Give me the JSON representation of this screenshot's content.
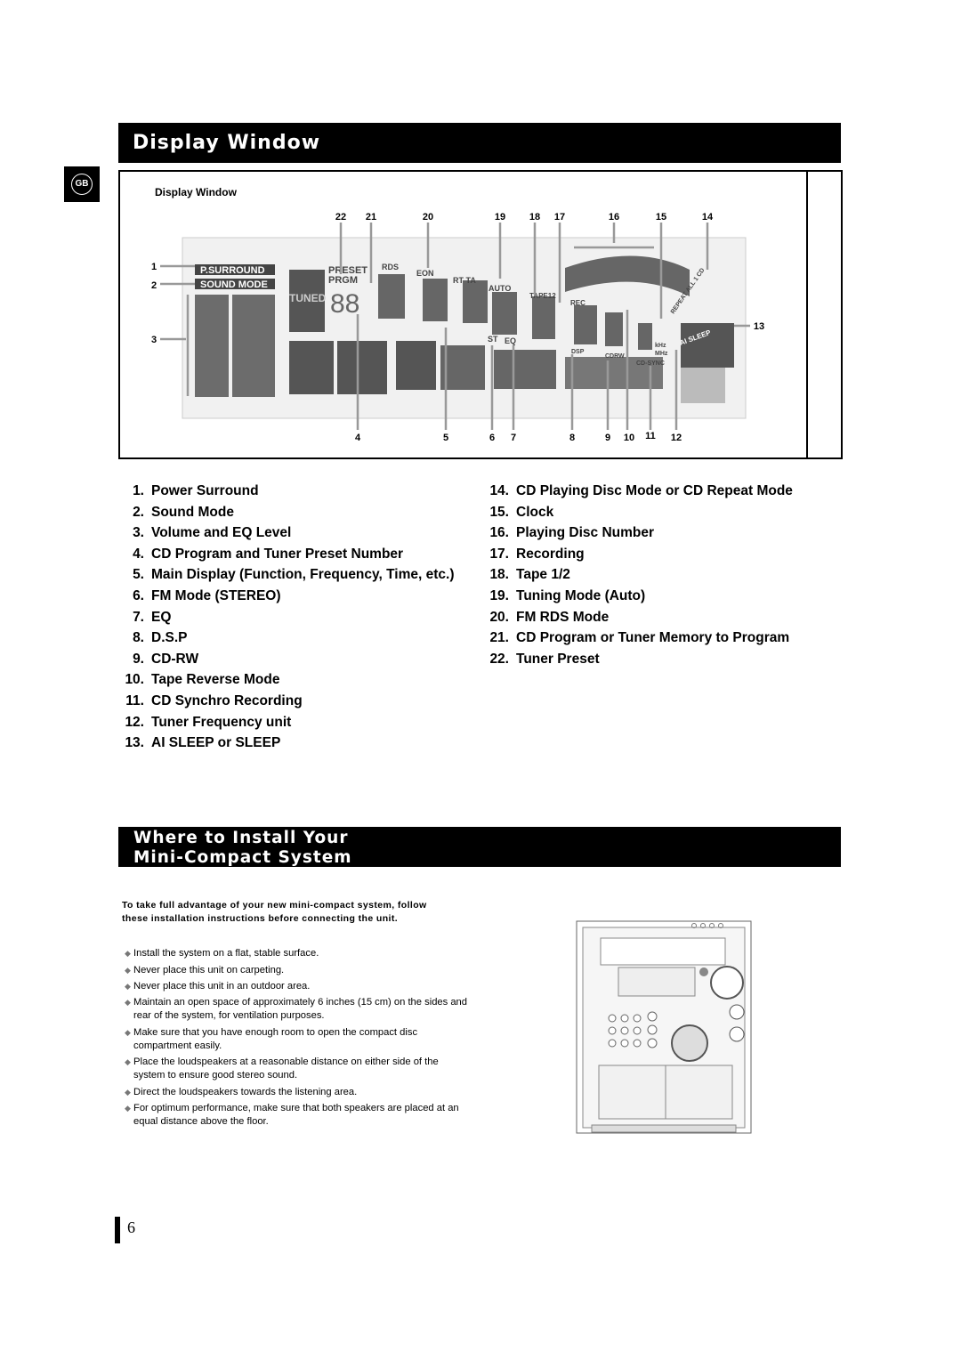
{
  "section1": {
    "title": "Display Window",
    "badge": "GB"
  },
  "diagram": {
    "caption": "Display Window",
    "lcd_labels": {
      "psurround": "P.SURROUND",
      "soundmode": "SOUND MODE",
      "tuned": "TUNED",
      "preset": "PRESET",
      "prgm": "PRGM",
      "rds": "RDS",
      "eon": "EON",
      "rtta": "RT TA",
      "auto": "AUTO",
      "tape": "TAPE12",
      "rec": "REC",
      "st": "ST",
      "eq": "EQ",
      "dsp": "DSP",
      "cdrw": "CDRW",
      "cdsync": "CD-SYNC",
      "khz": "kHz",
      "mhz": "MHz",
      "repeat": "REPEAT ALL 1 CD",
      "aisleep": "AI SLEEP"
    },
    "callouts_top": [
      "22",
      "21",
      "20",
      "19",
      "18",
      "17",
      "16",
      "15",
      "14"
    ],
    "callouts_left": [
      "1",
      "2",
      "3"
    ],
    "callouts_right": [
      "13"
    ],
    "callouts_bottom": [
      "4",
      "5",
      "6",
      "7",
      "8",
      "9",
      "10",
      "11",
      "12"
    ]
  },
  "legend_left": [
    {
      "n": "1.",
      "t": "Power Surround"
    },
    {
      "n": "2.",
      "t": "Sound Mode"
    },
    {
      "n": "3.",
      "t": "Volume and EQ Level"
    },
    {
      "n": "4.",
      "t": "CD Program and Tuner Preset Number"
    },
    {
      "n": "5.",
      "t": "Main Display (Function, Frequency, Time, etc.)"
    },
    {
      "n": "6.",
      "t": "FM Mode (STEREO)"
    },
    {
      "n": "7.",
      "t": "EQ"
    },
    {
      "n": "8.",
      "t": "D.S.P"
    },
    {
      "n": "9.",
      "t": "CD-RW"
    },
    {
      "n": "10.",
      "t": "Tape Reverse Mode"
    },
    {
      "n": "11.",
      "t": "CD Synchro Recording"
    },
    {
      "n": "12.",
      "t": "Tuner Frequency unit"
    },
    {
      "n": "13.",
      "t": "AI SLEEP or SLEEP"
    }
  ],
  "legend_right": [
    {
      "n": "14.",
      "t": "CD Playing Disc Mode or CD Repeat Mode"
    },
    {
      "n": "15.",
      "t": "Clock"
    },
    {
      "n": "16.",
      "t": "Playing Disc Number"
    },
    {
      "n": "17.",
      "t": "Recording"
    },
    {
      "n": "18.",
      "t": "Tape 1/2"
    },
    {
      "n": "19.",
      "t": "Tuning  Mode (Auto)"
    },
    {
      "n": "20.",
      "t": "FM RDS Mode"
    },
    {
      "n": "21.",
      "t": "CD Program or Tuner Memory to Program"
    },
    {
      "n": "22.",
      "t": "Tuner Preset"
    }
  ],
  "section2": {
    "title_line1": "Where to Install Your",
    "title_line2": "Mini-Compact System",
    "intro_line1": "To take full advantage of your new mini-compact system, follow",
    "intro_line2": "these installation instructions before connecting the unit.",
    "bullet_icon": "diamond-bullet-icon",
    "bullets": [
      "Install the system on a flat, stable surface.",
      "Never place this unit on carpeting.",
      "Never place this unit in an outdoor area.",
      "Maintain an open space of approximately 6 inches (15 cm) on the sides and rear of the system, for ventilation purposes.",
      "Make sure that you have enough room to open the compact disc compartment easily.",
      "Place the loudspeakers at a reasonable distance on either side of the system to ensure good stereo sound.",
      "Direct the loudspeakers towards the listening area.",
      "For optimum performance, make sure that both speakers are placed at an equal distance above the floor."
    ]
  },
  "footer": {
    "page_number": "6"
  }
}
